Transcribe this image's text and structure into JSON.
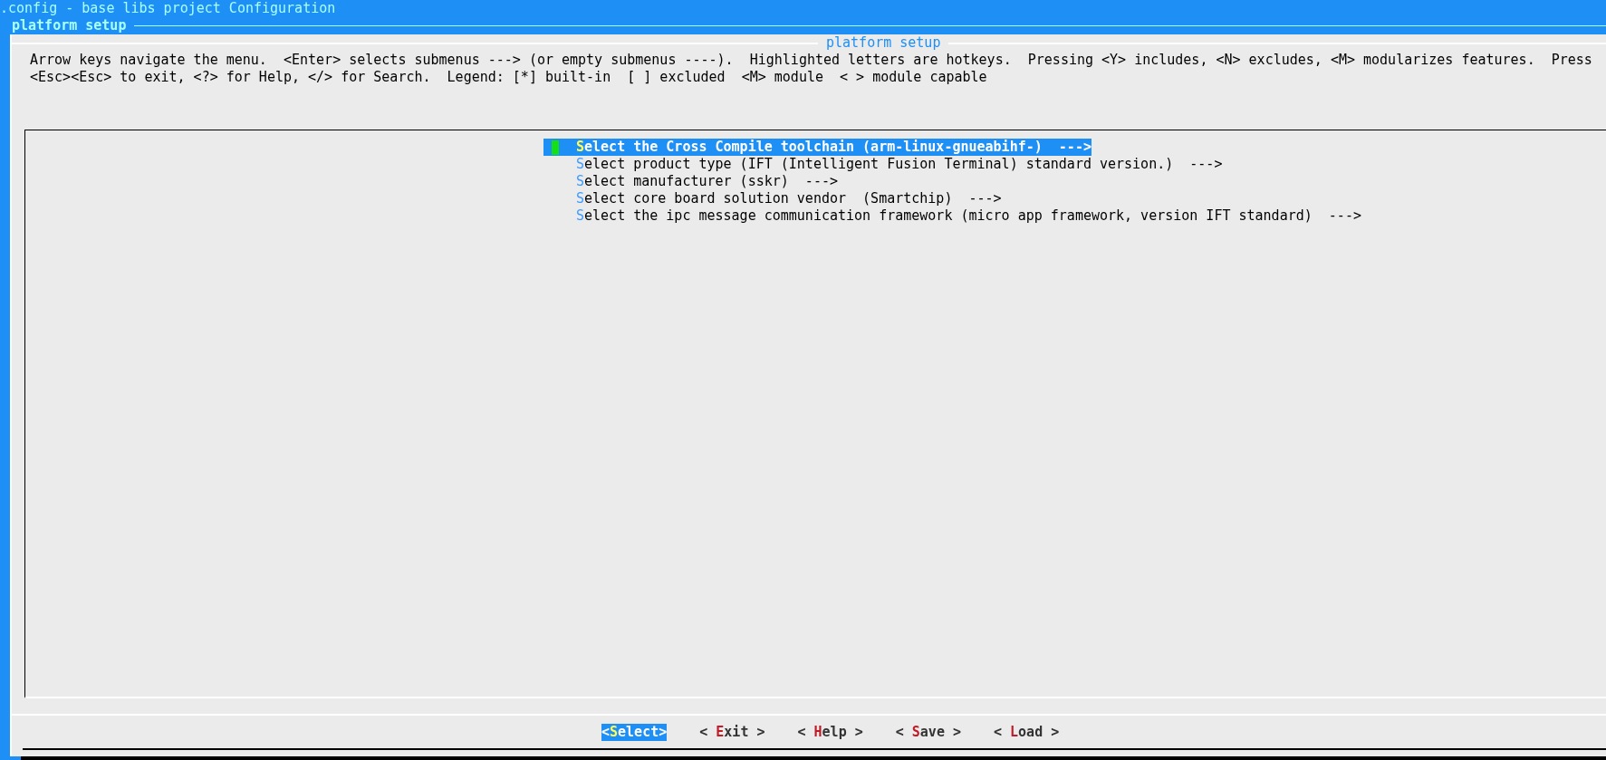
{
  "window": {
    "title": ".config - base libs project Configuration"
  },
  "breadcrumb": "platform setup",
  "dialog": {
    "title": "platform setup",
    "help_lines": [
      "Arrow keys navigate the menu.  <Enter> selects submenus ---> (or empty submenus ----).  Highlighted letters are hotkeys.  Pressing <Y> includes, <N> excludes, <M> modularizes features.  Press",
      "<Esc><Esc> to exit, <?> for Help, </> for Search.  Legend: [*] built-in  [ ] excluded  <M> module  < > module capable"
    ],
    "menu_items": [
      {
        "label": "Select the Cross Compile toolchain (arm-linux-gnueabihf-)  --->",
        "selected": true
      },
      {
        "label": "Select product type (IFT (Intelligent Fusion Terminal) standard version.)  --->",
        "selected": false
      },
      {
        "label": "Select manufacturer (sskr)  --->",
        "selected": false
      },
      {
        "label": "Select core board solution vendor  (Smartchip)  --->",
        "selected": false
      },
      {
        "label": "Select the ipc message communication framework (micro app framework, version IFT standard)  --->",
        "selected": false
      }
    ],
    "buttons": [
      {
        "label": "<Select>",
        "selected": true
      },
      {
        "label": "< Exit >",
        "selected": false
      },
      {
        "label": "< Help >",
        "selected": false
      },
      {
        "label": "< Save >",
        "selected": false
      },
      {
        "label": "< Load >",
        "selected": false
      }
    ]
  }
}
